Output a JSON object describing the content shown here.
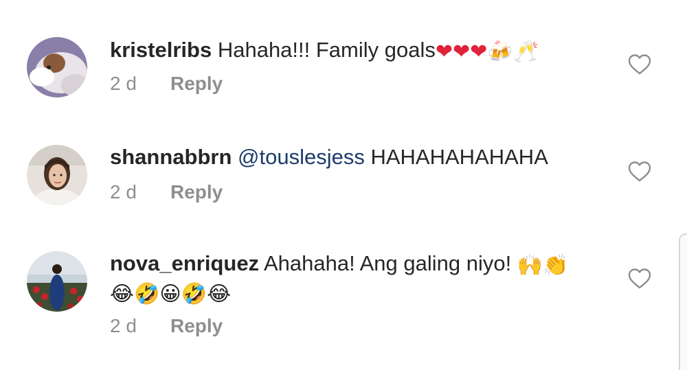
{
  "comments": [
    {
      "username": "kristelribs",
      "mention": "",
      "text": "Hahaha!!! Family goals",
      "emojis": [
        "❤",
        "❤",
        "❤",
        "🍻",
        "🥂"
      ],
      "emojis_line2": [],
      "time": "2 d",
      "reply_label": "Reply"
    },
    {
      "username": "shannabbrn",
      "mention": "@touslesjess",
      "text": "HAHAHAHAHAHA",
      "emojis": [],
      "emojis_line2": [],
      "time": "2 d",
      "reply_label": "Reply"
    },
    {
      "username": "nova_enriquez",
      "mention": "",
      "text": "Ahahaha! Ang galing niyo!",
      "emojis": [
        "🙌",
        "👏"
      ],
      "emojis_line2": [
        "😂",
        "🤣",
        "😀",
        "🤣",
        "😂"
      ],
      "time": "2 d",
      "reply_label": "Reply"
    }
  ],
  "colors": {
    "text": "#262626",
    "mention": "#1d3b6b",
    "meta": "#8e8e8e",
    "heart": "#e0223a"
  },
  "icons": {
    "like": "heart-outline-icon"
  }
}
